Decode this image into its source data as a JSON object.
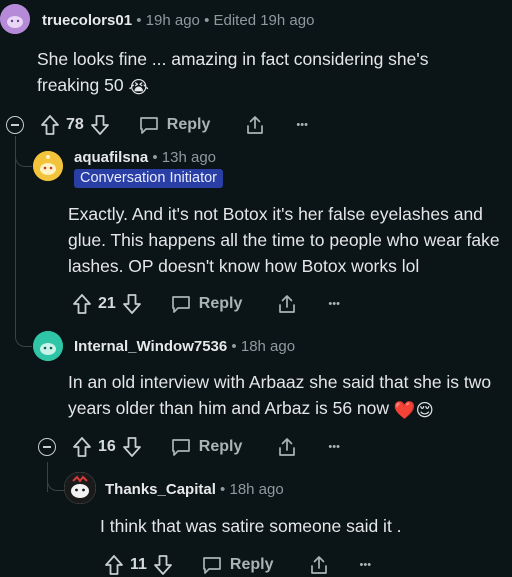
{
  "comments": [
    {
      "username": "truecolors01",
      "time": "19h ago",
      "edited": "Edited 19h ago",
      "text": "She looks fine ... amazing in fact considering she's freaking 50",
      "emoji": "😭",
      "votes": "78",
      "reply_label": "Reply",
      "avatar_color": "#b58ad9"
    },
    {
      "username": "aquafilsna",
      "time": "13h ago",
      "badge": "Conversation Initiator",
      "text": "Exactly. And it's not Botox it's her false eyelashes and glue. This happens all the time to people who wear fake lashes. OP doesn't know how Botox works lol",
      "votes": "21",
      "reply_label": "Reply",
      "avatar_color": "#f3c43b"
    },
    {
      "username": "Internal_Window7536",
      "time": "18h ago",
      "text": "In an old interview with Arbaaz she said that she is two years older than him and Arbaz is 56 now",
      "emoji": "❤️😌",
      "votes": "16",
      "reply_label": "Reply",
      "avatar_color": "#2fc5a7"
    },
    {
      "username": "Thanks_Capital",
      "time": "18h ago",
      "text": "I think that was satire someone said it .",
      "votes": "11",
      "reply_label": "Reply",
      "avatar_color": "#e6e6e6"
    }
  ],
  "icons": {
    "upvote": "arrow-up-icon",
    "downvote": "arrow-down-icon",
    "reply": "speech-bubble-icon",
    "share": "share-icon",
    "more": "ellipsis-icon",
    "collapse": "collapse-icon"
  },
  "separator": "•",
  "more_label": "•••"
}
